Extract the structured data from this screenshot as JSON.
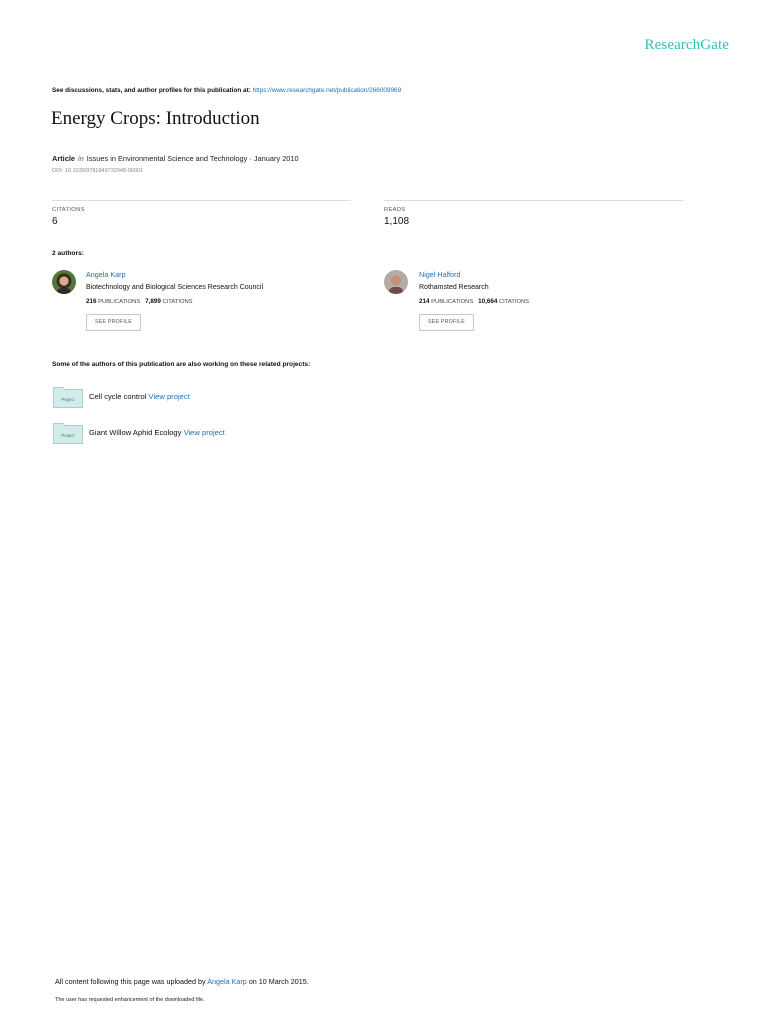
{
  "header": {
    "logo": "ResearchGate"
  },
  "notice": {
    "prefix": "See discussions, stats, and author profiles for this publication at:",
    "url": "https://www.researchgate.net/publication/266009969"
  },
  "publication": {
    "title": "Energy Crops: Introduction",
    "type": "Article",
    "in_word": "in",
    "venue_date": "Issues in Environmental Science and Technology · January 2010",
    "doi": "DOI: 10.1039/9781849732048-00001"
  },
  "stats": {
    "citations_label": "CITATIONS",
    "citations_value": "6",
    "reads_label": "READS",
    "reads_value": "1,108"
  },
  "authors_heading": "2 authors:",
  "authors": [
    {
      "name": "Angela Karp",
      "institution": "Biotechnology and Biological Sciences Research Council",
      "publications_count": "216",
      "publications_label": "PUBLICATIONS",
      "citations_count": "7,899",
      "citations_label": "CITATIONS",
      "button": "SEE PROFILE"
    },
    {
      "name": "Nigel Halford",
      "institution": "Rothamsted Research",
      "publications_count": "214",
      "publications_label": "PUBLICATIONS",
      "citations_count": "10,664",
      "citations_label": "CITATIONS",
      "button": "SEE PROFILE"
    }
  ],
  "related": {
    "heading": "Some of the authors of this publication are also working on these related projects:",
    "icon_label": "Project",
    "projects": [
      {
        "name": "Cell cycle control",
        "link": "View project"
      },
      {
        "name": "Giant Willow Aphid Ecology",
        "link": "View project"
      }
    ]
  },
  "footer": {
    "upload_prefix": "All content following this page was uploaded by",
    "uploader": "Angela Karp",
    "upload_suffix": "on 10 March 2015.",
    "enhancement": "The user has requested enhancement of the downloaded file."
  },
  "colors": {
    "brand": "#2dc2b5",
    "link": "#1f6fb0",
    "project_icon": "#cfe9e6"
  }
}
